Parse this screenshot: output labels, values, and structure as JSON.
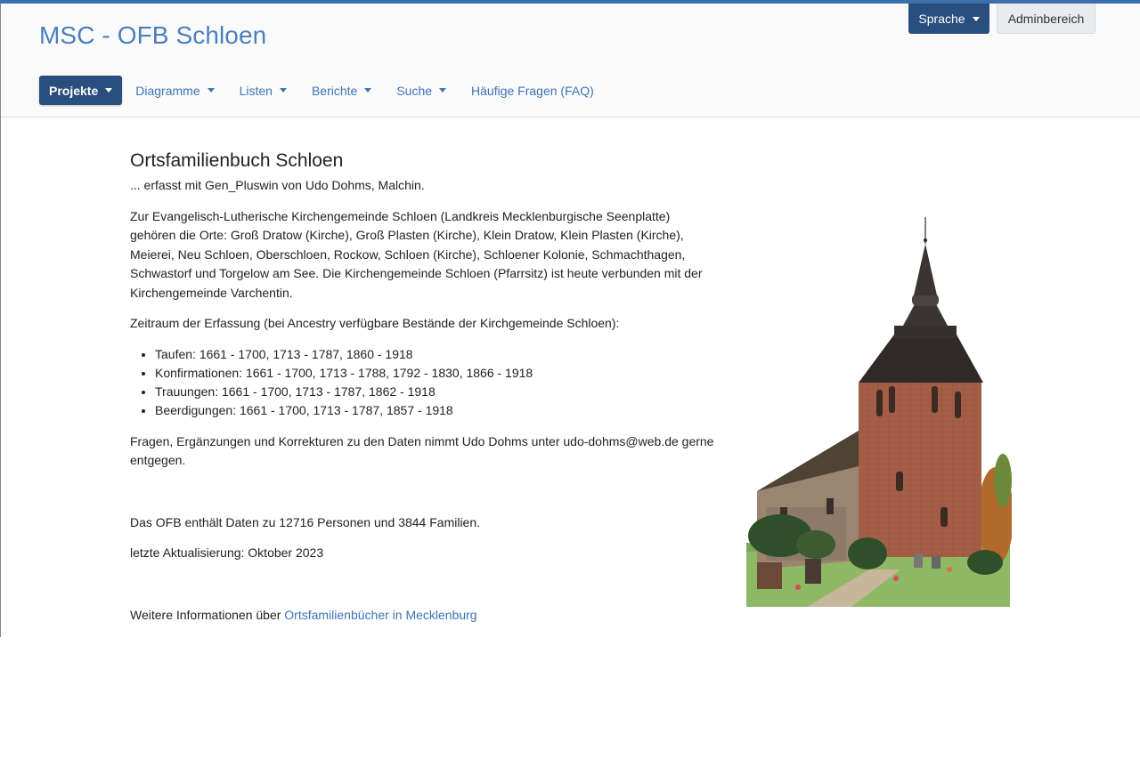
{
  "header": {
    "site_title": "MSC - OFB Schloen",
    "language_button": "Sprache",
    "admin_button": "Adminbereich"
  },
  "nav": {
    "items": [
      {
        "label": "Projekte",
        "active": true,
        "dropdown": true
      },
      {
        "label": "Diagramme",
        "dropdown": true
      },
      {
        "label": "Listen",
        "dropdown": true
      },
      {
        "label": "Berichte",
        "dropdown": true
      },
      {
        "label": "Suche",
        "dropdown": true
      },
      {
        "label": "Häufige Fragen (FAQ)",
        "dropdown": false
      }
    ]
  },
  "content": {
    "title": "Ortsfamilienbuch Schloen",
    "subtitle": "... erfasst mit Gen_Pluswin von Udo Dohms, Malchin.",
    "intro": "Zur Evangelisch-Lutherische Kirchengemeinde Schloen (Landkreis Mecklenburgische Seenplatte) gehören die Orte: Groß Dratow (Kirche), Groß Plasten (Kirche), Klein Dratow, Klein Plasten (Kirche), Meierei, Neu Schloen, Oberschloen, Rockow, Schloen (Kirche), Schloener Kolonie, Schmachthagen, Schwastorf und Torgelow am See. Die Kirchengemeinde Schloen (Pfarrsitz) ist heute verbunden mit der Kirchengemeinde Varchentin.",
    "period_heading": "Zeitraum der Erfassung (bei Ancestry verfügbare Bestände der Kirchgemeinde Schloen):",
    "periods": [
      "Taufen: 1661 - 1700, 1713 - 1787, 1860 - 1918",
      "Konfirmationen: 1661 - 1700, 1713 - 1788, 1792 - 1830, 1866 - 1918",
      "Trauungen: 1661 - 1700, 1713 - 1787, 1862 - 1918",
      "Beerdigungen: 1661 - 1700, 1713 - 1787, 1857 - 1918"
    ],
    "contact": "Fragen, Ergänzungen und Korrekturen zu den Daten nimmt Udo Dohms unter udo-dohms@web.de gerne entgegen.",
    "stats": "Das OFB enthält Daten zu 12716 Personen und 3844 Familien.",
    "updated": "letzte Aktualisierung: Oktober 2023",
    "more_info_prefix": "Weitere Informationen über ",
    "more_info_link": "Ortsfamilienbücher in Mecklenburg"
  },
  "colors": {
    "accent": "#3d74b8",
    "nav_active": "#2a4e7e",
    "title": "#4a7fbf"
  },
  "image": {
    "subject": "church-photo"
  }
}
